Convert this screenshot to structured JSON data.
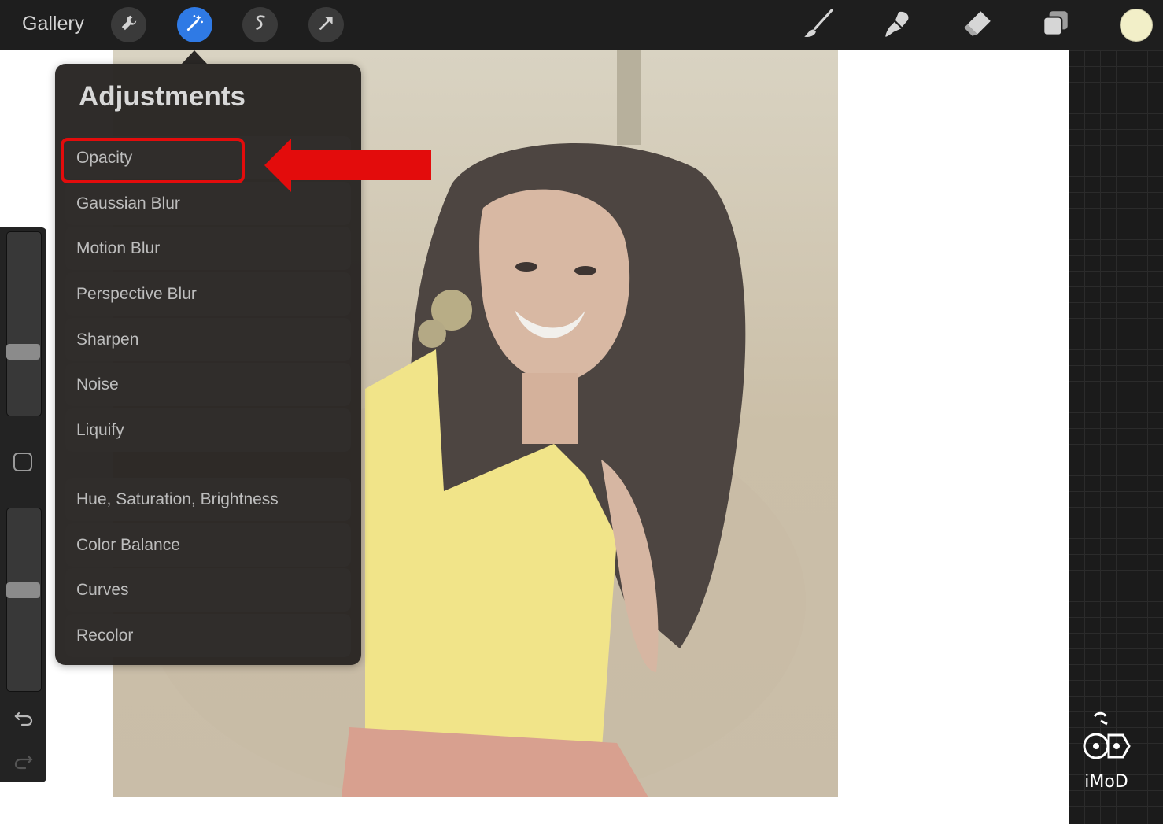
{
  "toolbar": {
    "gallery_label": "Gallery",
    "left_tools": [
      {
        "icon": "wrench-icon",
        "label": "Actions"
      },
      {
        "icon": "magic-wand-icon",
        "label": "Adjustments",
        "active": true
      },
      {
        "icon": "selection-icon",
        "label": "Selection"
      },
      {
        "icon": "transform-arrow-icon",
        "label": "Transform"
      }
    ],
    "right_tools": [
      {
        "icon": "brush-icon"
      },
      {
        "icon": "smudge-icon"
      },
      {
        "icon": "eraser-icon"
      },
      {
        "icon": "layers-icon"
      }
    ],
    "current_color": "#f2efc8",
    "accent_color": "#2f7ae5"
  },
  "adjustments": {
    "title": "Adjustments",
    "group1": [
      "Opacity",
      "Gaussian Blur",
      "Motion Blur",
      "Perspective Blur",
      "Sharpen",
      "Noise",
      "Liquify"
    ],
    "group2": [
      "Hue, Saturation, Brightness",
      "Color Balance",
      "Curves",
      "Recolor"
    ],
    "highlighted_item": "Opacity",
    "highlight_color": "#e30c0c"
  },
  "sidebar": {
    "brush_size_level": 0.33,
    "brush_opacity_level": 0.55
  },
  "watermark": {
    "text": "iMoD"
  }
}
